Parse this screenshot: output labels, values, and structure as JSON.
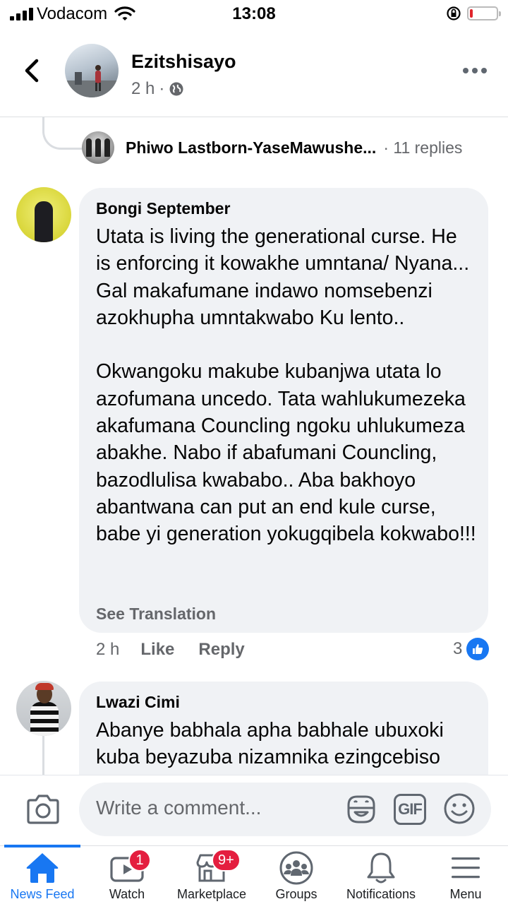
{
  "status_bar": {
    "carrier": "Vodacom",
    "time": "13:08",
    "battery_level": 0.1,
    "battery_color": "#e0242b"
  },
  "post_header": {
    "page_name": "Ezitshisayo",
    "post_time": "2 h",
    "separator": "·",
    "audience_icon": "globe-icon",
    "back_icon": "chevron-left-icon",
    "more_icon": "more-horizontal-icon"
  },
  "reply_thread": {
    "author": "Phiwo Lastborn-YaseMawushe...",
    "separator": "·",
    "replies": "11 replies"
  },
  "comments": [
    {
      "author": "Bongi September",
      "text": "Utata is living the generational curse. He is enforcing it kowakhe umntana/ Nyana... Gal makafumane indawo nomsebenzi azokhupha umntakwabo Ku lento..\n\nOkwangoku makube kubanjwa utata lo azofumana uncedo. Tata wahlukumezeka akafumana Councling ngoku uhlukumeza abakhe. Nabo if abafumani Councling, bazodlulisa kwababo.. Aba bakhoyo abantwana can put an end kule curse, babe yi generation yokugqibela kokwabo!!!",
      "see_translation": "See Translation",
      "time": "2 h",
      "like_label": "Like",
      "reply_label": "Reply",
      "reaction_count": "3",
      "reaction_icon": "like-icon"
    },
    {
      "author": "Lwazi Cimi",
      "text": "Abanye babhala apha babhale ubuxoki kuba beyazuba nizamnika ezingcebiso"
    }
  ],
  "composer": {
    "placeholder": "Write a comment...",
    "camera_icon": "camera-icon",
    "sticker_icon": "sticker-icon",
    "gif_label": "GIF",
    "emoji_icon": "emoji-icon"
  },
  "bottom_nav": {
    "accent_color": "#1877f2",
    "items": [
      {
        "label": "News Feed",
        "icon": "home-icon",
        "active": true
      },
      {
        "label": "Watch",
        "icon": "watch-icon",
        "badge": "1"
      },
      {
        "label": "Marketplace",
        "icon": "marketplace-icon",
        "badge": "9+"
      },
      {
        "label": "Groups",
        "icon": "groups-icon"
      },
      {
        "label": "Notifications",
        "icon": "bell-icon"
      },
      {
        "label": "Menu",
        "icon": "menu-icon"
      }
    ]
  }
}
